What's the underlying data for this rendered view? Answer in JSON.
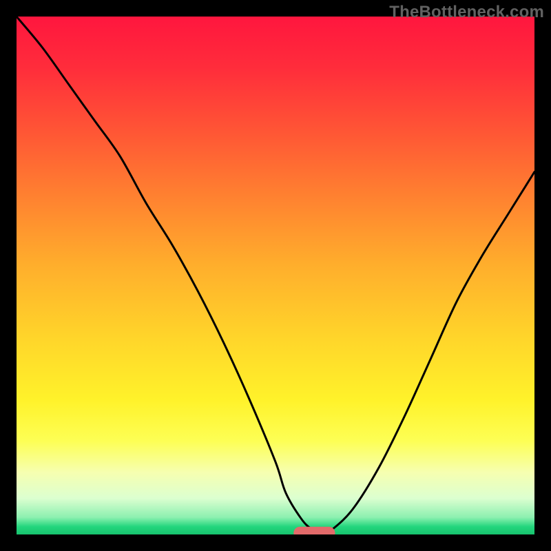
{
  "watermark": "TheBottleneck.com",
  "chart_data": {
    "type": "line",
    "title": "",
    "xlabel": "",
    "ylabel": "",
    "xlim": [
      0,
      100
    ],
    "ylim": [
      0,
      100
    ],
    "grid": false,
    "legend": false,
    "curve": {
      "x": [
        0,
        5,
        10,
        15,
        20,
        25,
        30,
        35,
        40,
        45,
        50,
        52,
        55,
        57,
        59,
        61,
        65,
        70,
        75,
        80,
        85,
        90,
        95,
        100
      ],
      "y": [
        100,
        94,
        87,
        80,
        73,
        64,
        56,
        47,
        37,
        26,
        14,
        8,
        3,
        1,
        0,
        1,
        5,
        13,
        23,
        34,
        45,
        54,
        62,
        70
      ]
    },
    "marker": {
      "shape": "capsule",
      "center_x": 57.5,
      "center_y": 0.3,
      "width": 8,
      "height": 2.4,
      "color": "#e26a6a"
    },
    "gradient_stops": [
      {
        "offset": 0.0,
        "color": "#ff163e"
      },
      {
        "offset": 0.1,
        "color": "#ff2d3b"
      },
      {
        "offset": 0.22,
        "color": "#ff5535"
      },
      {
        "offset": 0.35,
        "color": "#ff8230"
      },
      {
        "offset": 0.48,
        "color": "#ffae2c"
      },
      {
        "offset": 0.62,
        "color": "#ffd52a"
      },
      {
        "offset": 0.74,
        "color": "#fff22a"
      },
      {
        "offset": 0.82,
        "color": "#fdff55"
      },
      {
        "offset": 0.88,
        "color": "#f6ffb0"
      },
      {
        "offset": 0.93,
        "color": "#dcffd0"
      },
      {
        "offset": 0.967,
        "color": "#8cf0b0"
      },
      {
        "offset": 0.985,
        "color": "#23d67d"
      },
      {
        "offset": 1.0,
        "color": "#17c36e"
      }
    ]
  }
}
